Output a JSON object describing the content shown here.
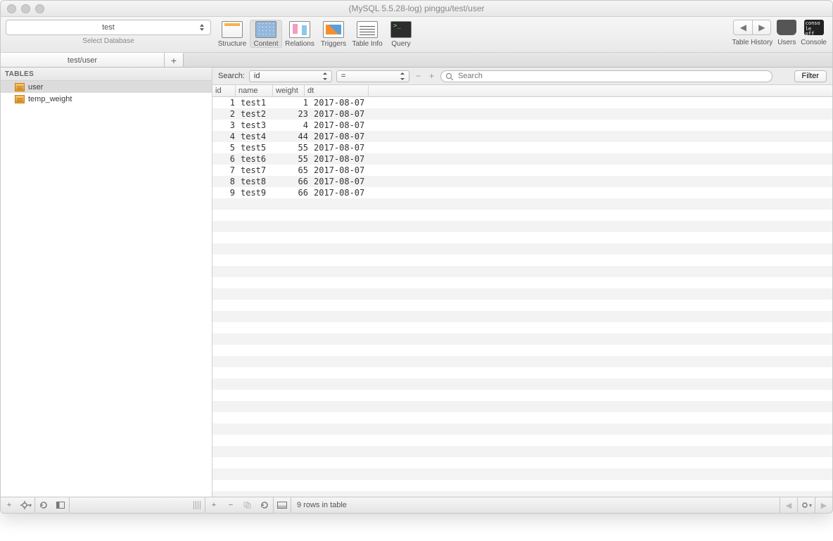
{
  "title": "(MySQL 5.5.28-log) pinggu/test/user",
  "db_select": {
    "value": "test",
    "caption": "Select Database"
  },
  "toolbar": {
    "structure": "Structure",
    "content": "Content",
    "relations": "Relations",
    "triggers": "Triggers",
    "tableinfo": "Table Info",
    "query": "Query",
    "history": "Table History",
    "users": "Users",
    "console": "Console",
    "console_text": "conso\nle off"
  },
  "tabs": {
    "main": "test/user",
    "add": "+"
  },
  "sidebar": {
    "header": "TABLES",
    "items": [
      {
        "label": "user"
      },
      {
        "label": "temp_weight"
      }
    ]
  },
  "search": {
    "label": "Search:",
    "field": "id",
    "op": "=",
    "placeholder": "Search",
    "filter": "Filter"
  },
  "columns": [
    "id",
    "name",
    "weight",
    "dt"
  ],
  "rows": [
    {
      "id": "1",
      "name": "test1",
      "weight": "1",
      "dt": "2017-08-07"
    },
    {
      "id": "2",
      "name": "test2",
      "weight": "23",
      "dt": "2017-08-07"
    },
    {
      "id": "3",
      "name": "test3",
      "weight": "4",
      "dt": "2017-08-07"
    },
    {
      "id": "4",
      "name": "test4",
      "weight": "44",
      "dt": "2017-08-07"
    },
    {
      "id": "5",
      "name": "test5",
      "weight": "55",
      "dt": "2017-08-07"
    },
    {
      "id": "6",
      "name": "test6",
      "weight": "55",
      "dt": "2017-08-07"
    },
    {
      "id": "7",
      "name": "test7",
      "weight": "65",
      "dt": "2017-08-07"
    },
    {
      "id": "8",
      "name": "test8",
      "weight": "66",
      "dt": "2017-08-07"
    },
    {
      "id": "9",
      "name": "test9",
      "weight": "66",
      "dt": "2017-08-07"
    }
  ],
  "status": "9 rows in table"
}
